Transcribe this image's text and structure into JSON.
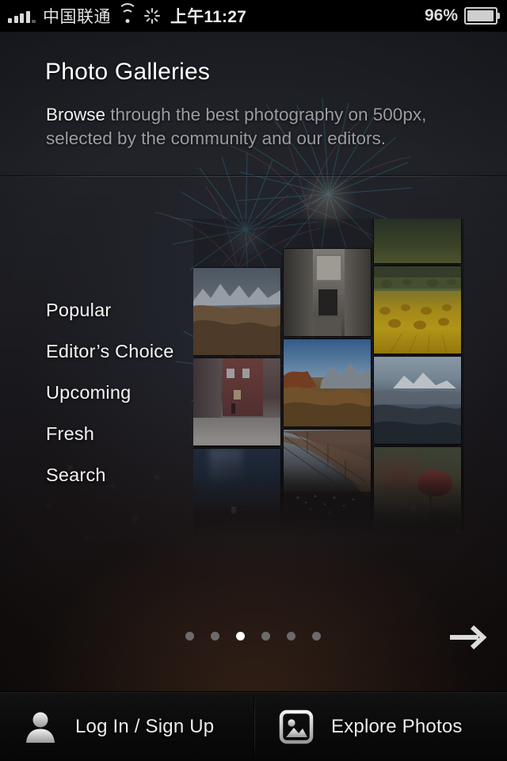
{
  "statusbar": {
    "carrier": "中国联通",
    "signal_icon": "signal-bars-icon",
    "wifi_icon": "wifi-icon",
    "activity_icon": "activity-spinner-icon",
    "time": "上午11:27",
    "battery_percent": "96%",
    "battery_icon": "battery-icon"
  },
  "header": {
    "title": "Photo Galleries",
    "subtitle_strong": "Browse",
    "subtitle_rest": " through the best photography on 500px, selected by the community and our editors."
  },
  "menu": {
    "items": [
      {
        "label": "Popular"
      },
      {
        "label": "Editor’s Choice"
      },
      {
        "label": "Upcoming"
      },
      {
        "label": "Fresh"
      },
      {
        "label": "Search"
      }
    ]
  },
  "gallery": {
    "columns": [
      {
        "tiles": [
          {
            "name": "snow-mountain-range-photo"
          },
          {
            "name": "red-brick-alley-street-photo"
          },
          {
            "name": "milky-way-night-sky-photo"
          },
          {
            "name": "dark-partial-photo"
          }
        ]
      },
      {
        "tiles": [
          {
            "name": "stone-alley-gate-photo"
          },
          {
            "name": "autumn-mountain-valley-photo"
          },
          {
            "name": "eiffel-tower-photo"
          },
          {
            "name": "dark-partial-photo"
          }
        ]
      },
      {
        "tiles": [
          {
            "name": "green-hills-partial-photo"
          },
          {
            "name": "golden-hay-field-photo"
          },
          {
            "name": "snow-peak-aerial-photo"
          },
          {
            "name": "red-poppy-flower-photo"
          }
        ]
      }
    ]
  },
  "pager": {
    "total": 6,
    "active_index": 2,
    "next_icon": "arrow-right-icon"
  },
  "bottombar": {
    "login": {
      "label": "Log In / Sign Up",
      "icon": "person-icon"
    },
    "explore": {
      "label": "Explore Photos",
      "icon": "photo-icon"
    }
  },
  "colors": {
    "accent_white": "#ffffff",
    "muted_text": "#9b9ca0",
    "dot_inactive": "#6b6b6b",
    "background_top": "#1d1f26",
    "background_bottom": "#090809"
  }
}
